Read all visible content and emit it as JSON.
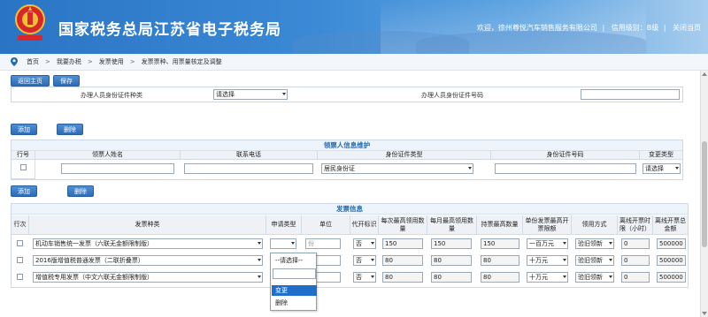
{
  "header": {
    "title": "国家税务总局江苏省电子税务局",
    "emblem_caption": "国家税务总局",
    "welcome": "欢迎，徐州尊悦汽车销售服务有限公司",
    "credit_label": "信用级别：B级",
    "separator": "|",
    "close_label": "关闭当页",
    "colors": {
      "header_start": "#2a74c4",
      "header_end": "#a8cdee"
    }
  },
  "breadcrumb": {
    "items": [
      "首页",
      "我要办税",
      "发票使用",
      "发票票种、用票量核定及调整"
    ],
    "separator": ">"
  },
  "toolbar": {
    "back_label": "返回主页",
    "save_label": "保存"
  },
  "handler": {
    "id_type_label": "办理人员身份证件种类",
    "id_type_value": "请选择",
    "id_no_label": "办理人员身份证件号码",
    "id_no_value": ""
  },
  "recipient_actions": {
    "add_label": "添加",
    "delete_label": "删除"
  },
  "recipient_section": {
    "title": "领票人信息维护",
    "columns": [
      "行号",
      "领票人姓名",
      "联系电话",
      "身份证件类型",
      "身份证件号码",
      "变更类型"
    ],
    "rows": [
      {
        "row_no": "",
        "name": "",
        "phone": "",
        "id_type": "居民身份证",
        "id_no": "",
        "change_type": "请选择"
      }
    ]
  },
  "invoice_actions": {
    "add_label": "添加",
    "delete_label": "删除"
  },
  "invoice_section": {
    "title": "发票信息",
    "columns": [
      "行次",
      "发票种类",
      "申请类型",
      "单位",
      "代开标识",
      "每次最高领用数量",
      "每月最高领用数量",
      "持票最高数量",
      "单份发票最高开票限额",
      "领用方式",
      "离线开票时限（小时）",
      "离线开票总金额"
    ],
    "rows": [
      {
        "type": "机动车销售统一发票（六联无金额限制版）",
        "apply": "",
        "unit": "份",
        "agent": "否",
        "per_time": "150",
        "per_month": "150",
        "hold": "150",
        "limit": "一百万元",
        "method": "验旧领新",
        "offline_hours": "0",
        "offline_amount": "500000"
      },
      {
        "type": "2016版增值税普通发票（二联折叠票）",
        "apply": "--请选择--",
        "unit": "",
        "agent": "否",
        "per_time": "80",
        "per_month": "80",
        "hold": "80",
        "limit": "十万元",
        "method": "验旧领新",
        "offline_hours": "0",
        "offline_amount": "500000"
      },
      {
        "type": "增值税专用发票（中文六联无金额限制版）",
        "apply": "",
        "unit": "",
        "agent": "否",
        "per_time": "80",
        "per_month": "80",
        "hold": "80",
        "limit": "十万元",
        "method": "验旧领新",
        "offline_hours": "0",
        "offline_amount": "500000"
      }
    ]
  },
  "apply_dropdown": {
    "placeholder": "--请选择--",
    "options": [
      "变更",
      "删除"
    ],
    "highlighted": "变更"
  }
}
